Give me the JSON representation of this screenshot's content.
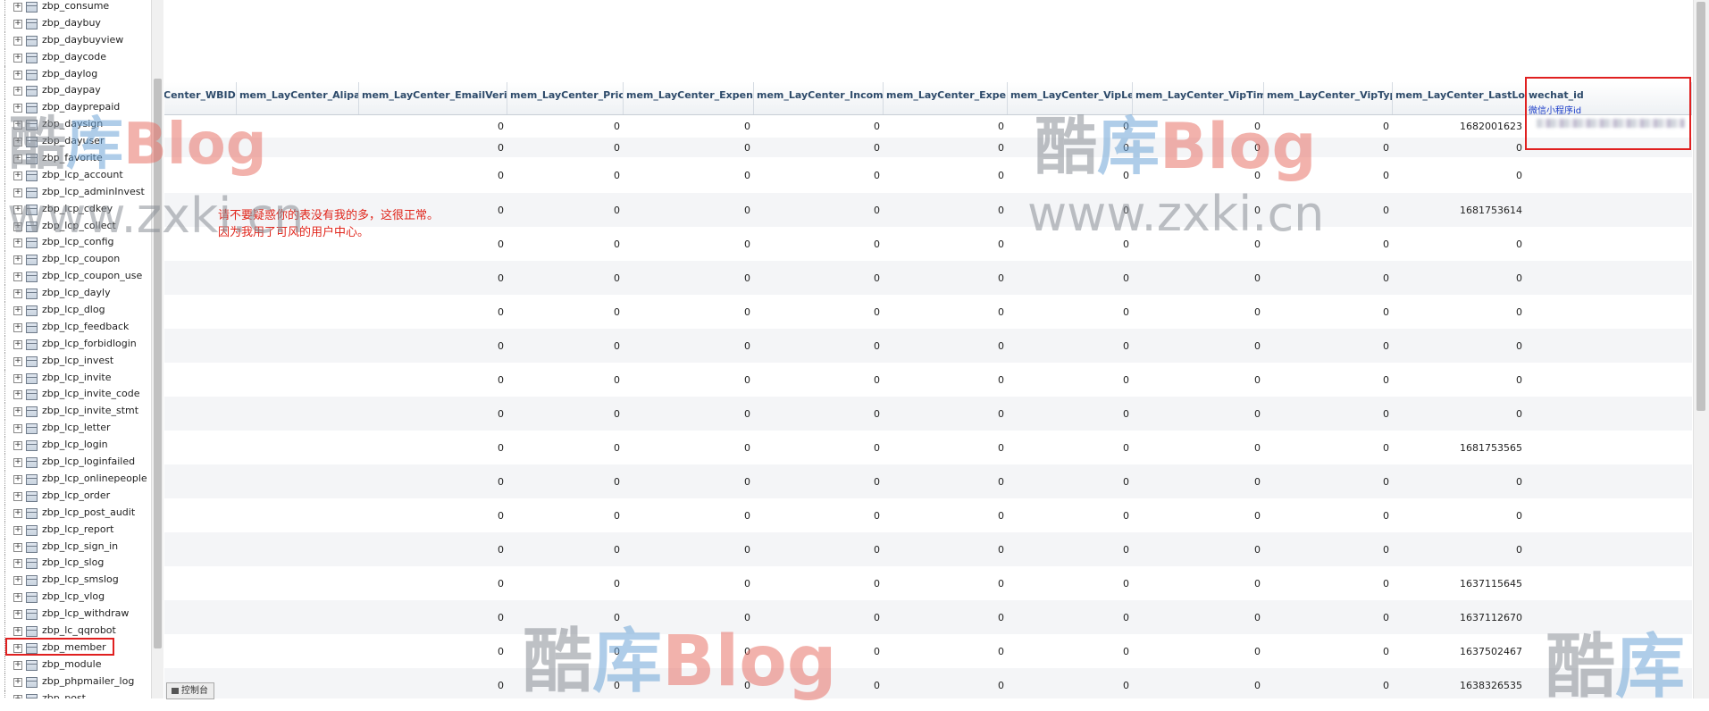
{
  "sidebar": {
    "tables": [
      "zbp_consume",
      "zbp_daybuy",
      "zbp_daybuyview",
      "zbp_daycode",
      "zbp_daylog",
      "zbp_daypay",
      "zbp_dayprepaid",
      "zbp_daysign",
      "zbp_dayuser",
      "zbp_favorite",
      "zbp_lcp_account",
      "zbp_lcp_adminInvest",
      "zbp_lcp_cdkey",
      "zbp_lcp_collect",
      "zbp_lcp_config",
      "zbp_lcp_coupon",
      "zbp_lcp_coupon_use",
      "zbp_lcp_dayly",
      "zbp_lcp_dlog",
      "zbp_lcp_feedback",
      "zbp_lcp_forbidlogin",
      "zbp_lcp_invest",
      "zbp_lcp_invite",
      "zbp_lcp_invite_code",
      "zbp_lcp_invite_stmt",
      "zbp_lcp_letter",
      "zbp_lcp_login",
      "zbp_lcp_loginfailed",
      "zbp_lcp_onlinepeople",
      "zbp_lcp_order",
      "zbp_lcp_post_audit",
      "zbp_lcp_report",
      "zbp_lcp_sign_in",
      "zbp_lcp_slog",
      "zbp_lcp_smslog",
      "zbp_lcp_vlog",
      "zbp_lcp_withdraw",
      "zbp_lc_qqrobot",
      "zbp_member",
      "zbp_module",
      "zbp_phpmailer_log",
      "zbp_post"
    ],
    "selected": "zbp_member"
  },
  "grid": {
    "columns": [
      {
        "name": "Center_WBID"
      },
      {
        "name": "mem_LayCenter_Alipay"
      },
      {
        "name": "mem_LayCenter_EmailVerify"
      },
      {
        "name": "mem_LayCenter_Price"
      },
      {
        "name": "mem_LayCenter_Expend"
      },
      {
        "name": "mem_LayCenter_Income"
      },
      {
        "name": "mem_LayCenter_Exper"
      },
      {
        "name": "mem_LayCenter_VipLevel"
      },
      {
        "name": "mem_LayCenter_VipTime"
      },
      {
        "name": "mem_LayCenter_VipType"
      },
      {
        "name": "mem_LayCenter_LastLogin"
      },
      {
        "name": "wechat_id",
        "comment": "微信小程序id"
      }
    ],
    "rows": [
      [
        "",
        "",
        "0",
        "0",
        "0",
        "0",
        "0",
        "0",
        "0",
        "0",
        "1682001623",
        ""
      ],
      [
        "",
        "",
        "0",
        "0",
        "0",
        "0",
        "0",
        "0",
        "0",
        "0",
        "0",
        ""
      ],
      [
        "",
        "",
        "0",
        "0",
        "0",
        "0",
        "0",
        "0",
        "0",
        "0",
        "0",
        ""
      ],
      [
        "",
        "",
        "0",
        "0",
        "0",
        "0",
        "0",
        "0",
        "0",
        "0",
        "1681753614",
        ""
      ],
      [
        "",
        "",
        "0",
        "0",
        "0",
        "0",
        "0",
        "0",
        "0",
        "0",
        "0",
        ""
      ],
      [
        "",
        "",
        "0",
        "0",
        "0",
        "0",
        "0",
        "0",
        "0",
        "0",
        "0",
        ""
      ],
      [
        "",
        "",
        "0",
        "0",
        "0",
        "0",
        "0",
        "0",
        "0",
        "0",
        "0",
        ""
      ],
      [
        "",
        "",
        "0",
        "0",
        "0",
        "0",
        "0",
        "0",
        "0",
        "0",
        "0",
        ""
      ],
      [
        "",
        "",
        "0",
        "0",
        "0",
        "0",
        "0",
        "0",
        "0",
        "0",
        "0",
        ""
      ],
      [
        "",
        "",
        "0",
        "0",
        "0",
        "0",
        "0",
        "0",
        "0",
        "0",
        "0",
        ""
      ],
      [
        "",
        "",
        "0",
        "0",
        "0",
        "0",
        "0",
        "0",
        "0",
        "0",
        "1681753565",
        ""
      ],
      [
        "",
        "",
        "0",
        "0",
        "0",
        "0",
        "0",
        "0",
        "0",
        "0",
        "0",
        ""
      ],
      [
        "",
        "",
        "0",
        "0",
        "0",
        "0",
        "0",
        "0",
        "0",
        "0",
        "0",
        ""
      ],
      [
        "",
        "",
        "0",
        "0",
        "0",
        "0",
        "0",
        "0",
        "0",
        "0",
        "0",
        ""
      ],
      [
        "",
        "",
        "0",
        "0",
        "0",
        "0",
        "0",
        "0",
        "0",
        "0",
        "1637115645",
        ""
      ],
      [
        "",
        "",
        "0",
        "0",
        "0",
        "0",
        "0",
        "0",
        "0",
        "0",
        "1637112670",
        ""
      ],
      [
        "",
        "",
        "0",
        "0",
        "0",
        "0",
        "0",
        "0",
        "0",
        "0",
        "1637502467",
        ""
      ],
      [
        "",
        "",
        "0",
        "0",
        "0",
        "0",
        "0",
        "0",
        "0",
        "0",
        "1638326535",
        ""
      ]
    ]
  },
  "annotation": {
    "line1": "请不要疑惑你的表没有我的多，这很正常。",
    "line2": "因为我用了可风的用户中心。"
  },
  "console_tab": "控制台",
  "watermark": {
    "cn1": "酷",
    "cn2": "库",
    "blog": "Blog",
    "url": "www.zxki.cn"
  },
  "colors": {
    "highlight": "#e02020",
    "header_text": "#2d4a6a",
    "annotation": "#e0251b"
  }
}
